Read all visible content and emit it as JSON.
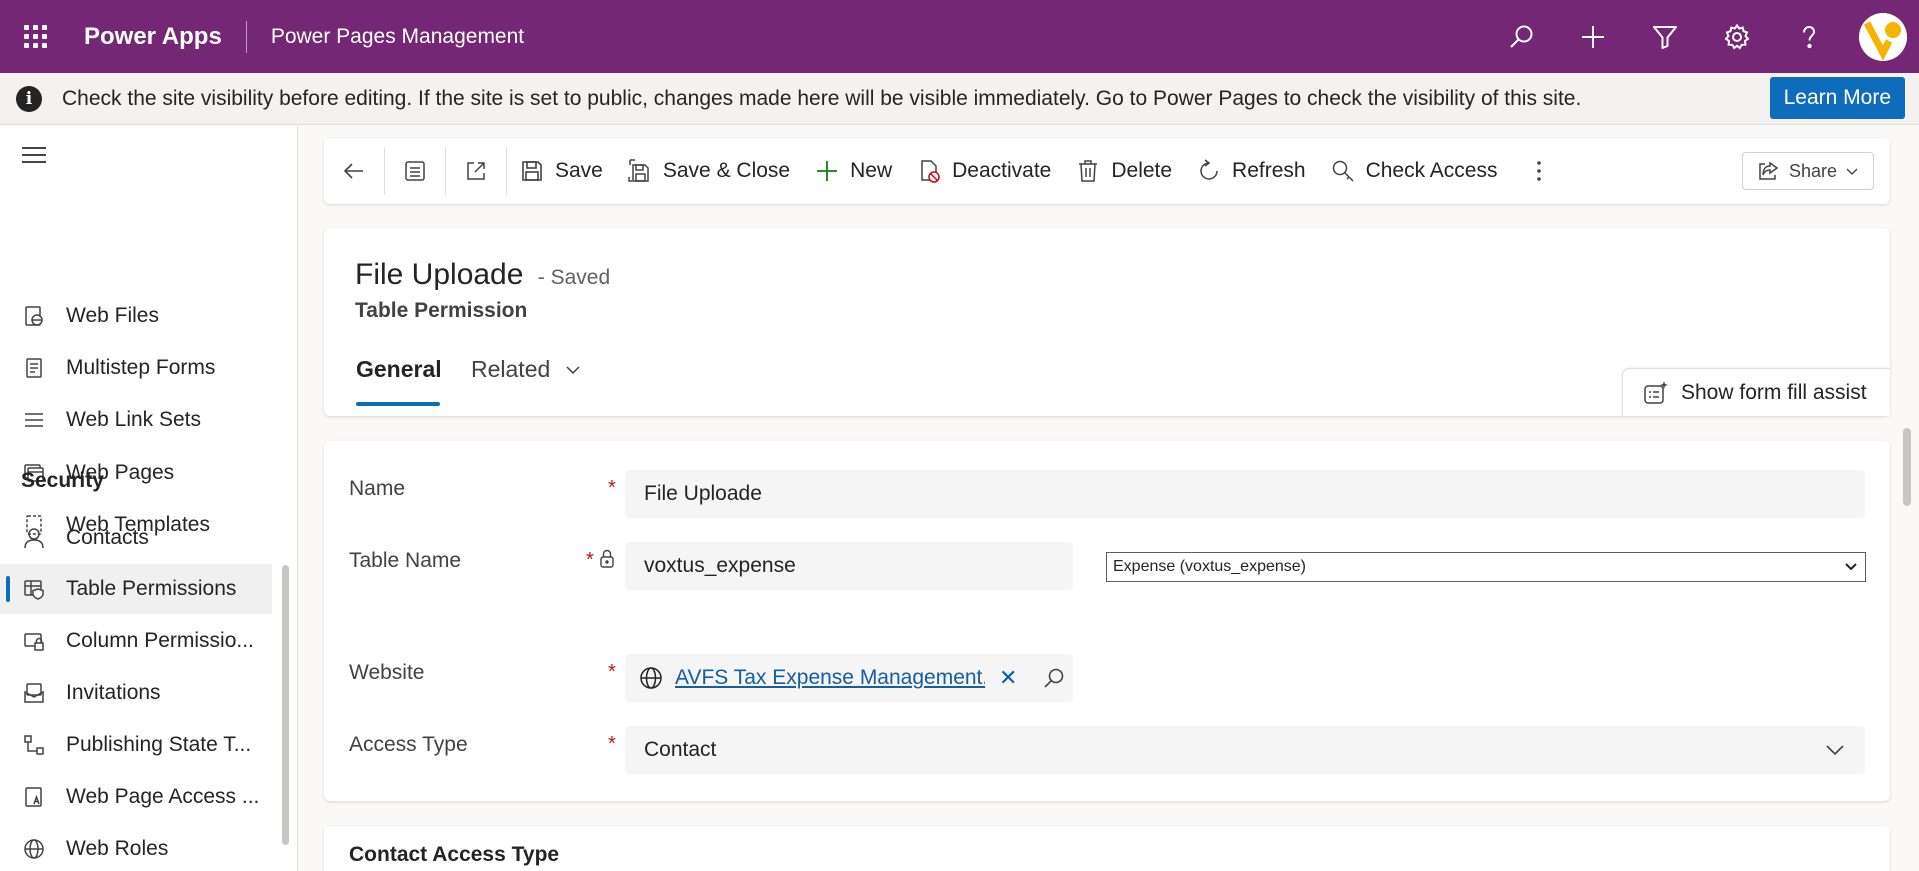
{
  "topbar": {
    "app_name": "Power Apps",
    "environment": "Power Pages Management",
    "icons": [
      "search-icon",
      "add-icon",
      "filter-icon",
      "settings-icon",
      "help-icon",
      "avatar"
    ],
    "color": "#742774"
  },
  "notification": {
    "text": "Check the site visibility before editing. If the site is set to public, changes made here will be visible immediately. Go to Power Pages to check the visibility of this site.",
    "button": "Learn More"
  },
  "sidebar": {
    "items_top": [
      {
        "label": "Web Files",
        "icon": "web-files-icon"
      },
      {
        "label": "Multistep Forms",
        "icon": "form-icon"
      },
      {
        "label": "Web Link Sets",
        "icon": "list-icon"
      },
      {
        "label": "Web Pages",
        "icon": "pages-icon"
      },
      {
        "label": "Web Templates",
        "icon": "template-icon"
      }
    ],
    "section": "Security",
    "items_security": [
      {
        "label": "Contacts",
        "icon": "person-icon"
      },
      {
        "label": "Table Permissions",
        "icon": "table-shield-icon",
        "selected": true
      },
      {
        "label": "Column Permissio...",
        "icon": "column-lock-icon"
      },
      {
        "label": "Invitations",
        "icon": "invitation-icon"
      },
      {
        "label": "Publishing State T...",
        "icon": "flow-icon"
      },
      {
        "label": "Web Page Access ...",
        "icon": "page-access-icon"
      },
      {
        "label": "Web Roles",
        "icon": "globe-icon"
      }
    ]
  },
  "commandbar": {
    "save": "Save",
    "save_close": "Save & Close",
    "new": "New",
    "deactivate": "Deactivate",
    "delete": "Delete",
    "refresh": "Refresh",
    "check_access": "Check Access",
    "share": "Share"
  },
  "record": {
    "title": "File Uploade",
    "status": "- Saved",
    "entity": "Table Permission",
    "tabs": {
      "general": "General",
      "related": "Related"
    },
    "form_assist": "Show form fill assist"
  },
  "form": {
    "name_label": "Name",
    "name_value": "File Uploade",
    "table_label": "Table Name",
    "table_value": "voxtus_expense",
    "table_select": "Expense (voxtus_expense)",
    "website_label": "Website",
    "website_value": "AVFS Tax Expense Management...",
    "access_label": "Access Type",
    "access_value": "Contact"
  },
  "section2": {
    "title": "Contact Access Type"
  }
}
